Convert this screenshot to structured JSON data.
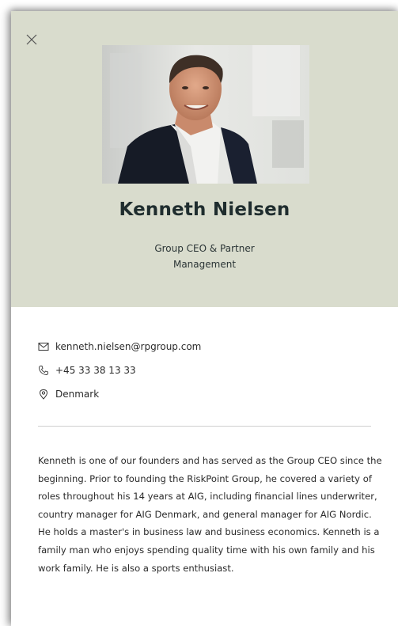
{
  "profile": {
    "name": "Kenneth Nielsen",
    "title": "Group CEO & Partner",
    "department": "Management"
  },
  "contact": {
    "email": "kenneth.nielsen@rpgroup.com",
    "phone": "+45 33 38 13 33",
    "location": "Denmark"
  },
  "bio": "Kenneth is one of our founders and has served as the Group CEO since the beginning. Prior to founding the RiskPoint Group, he covered a variety of roles throughout his 14 years at AIG, including financial lines underwriter, country manager for AIG Denmark, and general manager for AIG Nordic. He holds a master's in business law and business economics. Kenneth is a family man who enjoys spending quality time with his own family and his work family. He is also a sports enthusiast.",
  "icons": {
    "close": "close-icon",
    "email": "envelope-icon",
    "phone": "phone-icon",
    "location": "map-pin-icon"
  },
  "colors": {
    "header_bg": "#d9dccd",
    "name_color": "#1f2d2e",
    "text_color": "#2b2b2b"
  }
}
